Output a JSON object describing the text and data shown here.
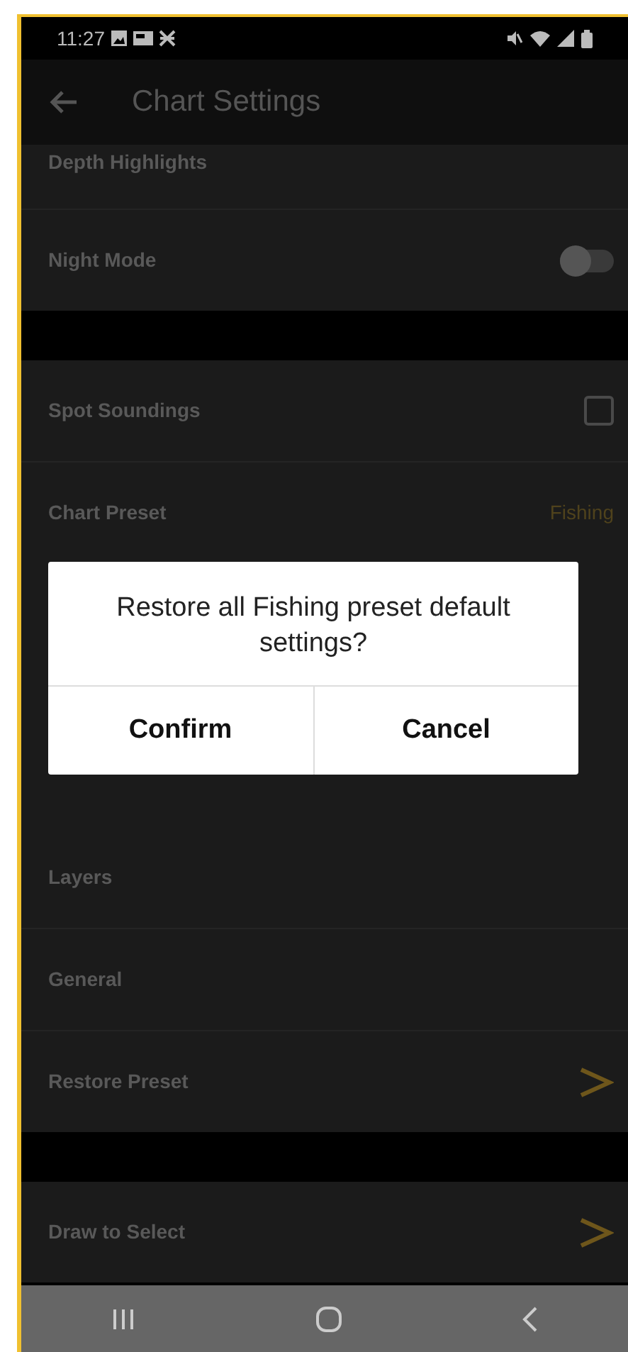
{
  "status_bar": {
    "time": "11:27"
  },
  "app_bar": {
    "title": "Chart Settings"
  },
  "sections": [
    {
      "rows": [
        {
          "label": "Depth Highlights",
          "kind": "cut"
        },
        {
          "label": "Night Mode",
          "kind": "toggle",
          "on": false
        }
      ]
    },
    {
      "rows": [
        {
          "label": "Spot Soundings",
          "kind": "checkbox",
          "checked": false
        },
        {
          "label": "Chart Preset",
          "kind": "value",
          "value": "Fishing"
        },
        {
          "kind": "covered"
        },
        {
          "label": "Layers",
          "kind": "plain"
        },
        {
          "label": "General",
          "kind": "plain"
        },
        {
          "label": "Restore Preset",
          "kind": "chevron"
        }
      ]
    },
    {
      "rows": [
        {
          "label": "Draw to Select",
          "kind": "chevron"
        }
      ]
    }
  ],
  "dialog": {
    "message": "Restore all Fishing preset default settings?",
    "buttons": [
      "Confirm",
      "Cancel"
    ]
  }
}
